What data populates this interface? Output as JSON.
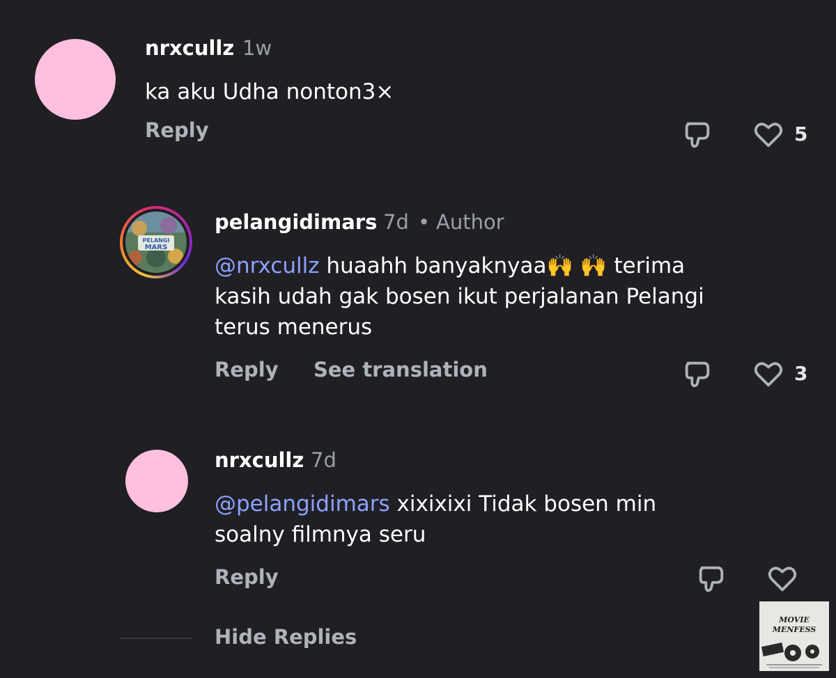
{
  "comments": [
    {
      "username": "nrxcullz",
      "time": "1w",
      "text": "ka aku Udha nonton3×",
      "reply_label": "Reply",
      "like_count": "5"
    },
    {
      "username": "pelangidimars",
      "time": "7d",
      "separator": "•",
      "badge": "Author",
      "mention": "@nrxcullz",
      "text_line1": " huaahh banyaknyaa🙌 🙌 terima",
      "text_line2": "kasih udah gak bosen ikut perjalanan Pelangi",
      "text_line3": "terus menerus",
      "reply_label": "Reply",
      "translate_label": "See translation",
      "like_count": "3",
      "avatar_text_top": "PELANGI",
      "avatar_text_bottom": "MARS"
    },
    {
      "username": "nrxcullz",
      "time": "7d",
      "mention": "@pelangidimars",
      "text_line1": " xixixixi Tidak bosen min",
      "text_line2": "soalny filmnya seru",
      "reply_label": "Reply"
    }
  ],
  "hide_replies_label": "Hide Replies",
  "watermark": {
    "line1": "MOVIE",
    "line2": "MENFESS"
  },
  "icons": {
    "dislike": "thumbs-down-icon",
    "like": "heart-icon"
  },
  "colors": {
    "background": "#1f1f24",
    "mention": "#8ea1ff",
    "avatar_pink": "#ffbfdf",
    "muted": "#9aa0a8"
  }
}
